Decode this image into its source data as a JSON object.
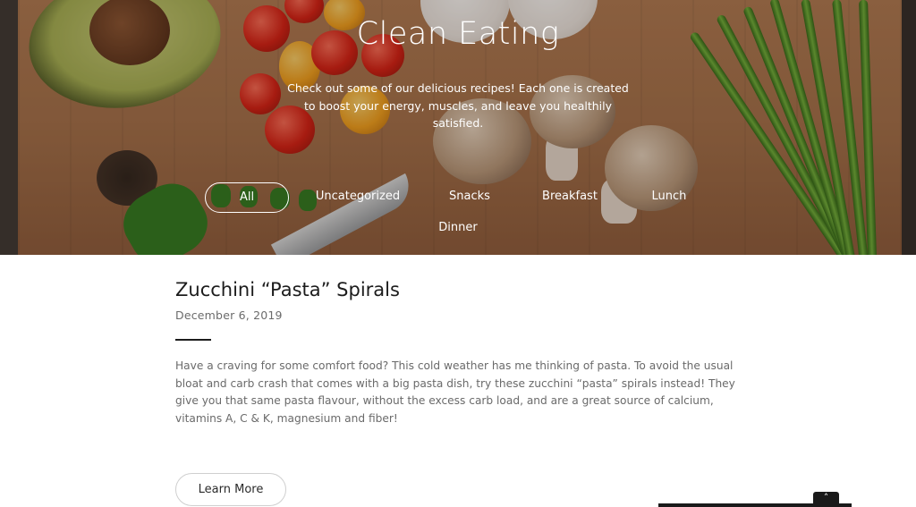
{
  "hero": {
    "title": "Clean Eating",
    "subtitle": "Check out some of our delicious recipes! Each one is created to boost your energy, muscles, and leave you healthily satisfied.",
    "filters": [
      {
        "label": "All",
        "active": true
      },
      {
        "label": "Uncategorized",
        "active": false
      },
      {
        "label": "Snacks",
        "active": false
      },
      {
        "label": "Breakfast",
        "active": false
      },
      {
        "label": "Lunch",
        "active": false
      },
      {
        "label": "Dinner",
        "active": false
      }
    ]
  },
  "post": {
    "title": "Zucchini “Pasta” Spirals",
    "date": "December 6, 2019",
    "excerpt": "Have a craving for some comfort food? This cold weather has me thinking of pasta. To avoid the usual bloat and carb crash that comes with a big pasta dish, try these zucchini “pasta” spirals instead! They give you that same pasta flavour, without the excess carb load, and are a great source of calcium, vitamins A, C & K, magnesium and fiber!",
    "button_label": "Learn More"
  },
  "scroll_top": {
    "icon": "chevron-up-icon",
    "glyph": "˄"
  },
  "colors": {
    "text_dark": "#1c1c1c",
    "text_muted": "#6a6a6a",
    "hero_overlay": "#28180e"
  }
}
